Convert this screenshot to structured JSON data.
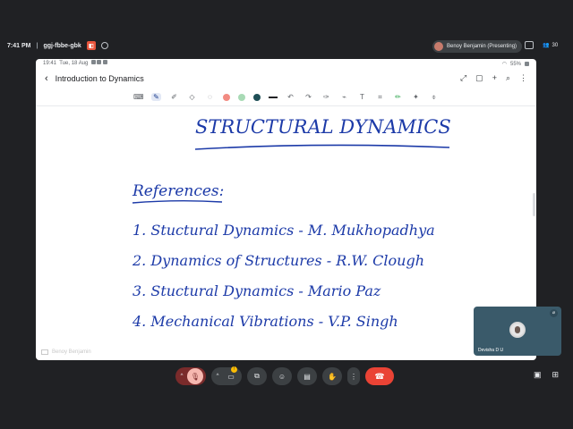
{
  "meet": {
    "time": "7:41 PM",
    "separator": "|",
    "meeting_code": "ggj-fbbe-gbk",
    "presenter_label": "Benoy Benjamin (Presenting)",
    "people_count": "30"
  },
  "tablet_status": {
    "time": "19:41",
    "date": "Tue, 18 Aug",
    "battery": "55%"
  },
  "notes_app": {
    "title": "Introduction to Dynamics",
    "colors": {
      "red": "#f28b82",
      "green": "#a8dab5",
      "teal": "#81c8c0",
      "black": "#202124"
    }
  },
  "handwriting": {
    "title": "STRUCTURAL DYNAMICS",
    "references_heading": "References:",
    "lines": [
      "1. Stuctural Dynamics - M. Mukhopadhya",
      "2. Dynamics of Structures - R.W. Clough",
      "3. Stuctural Dynamics - Mario Paz",
      "4. Mechanical Vibrations - V.P. Singh"
    ]
  },
  "watermark": "Benoy Benjamin",
  "participant": {
    "name": "Devisha D U"
  }
}
